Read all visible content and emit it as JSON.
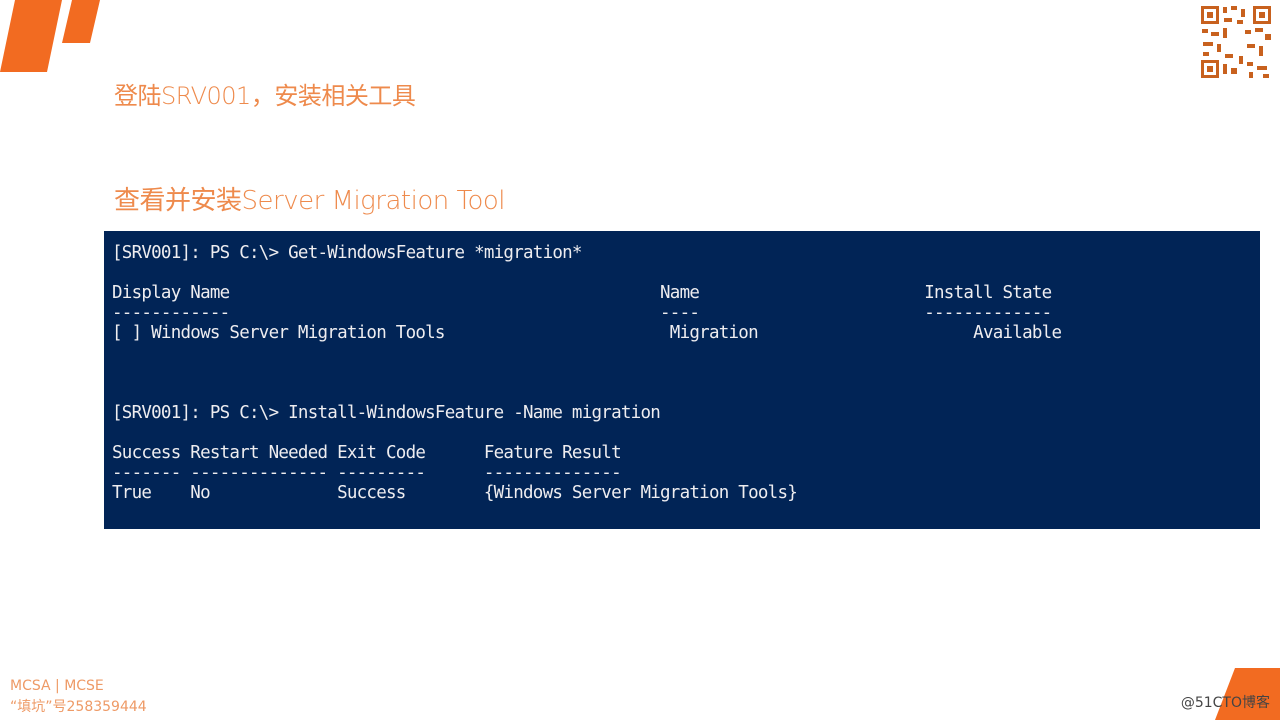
{
  "slide": {
    "heading1": "登陆SRV001，安装相关工具",
    "heading2": "查看并安装Server Migration Tool",
    "accent_color": "#f26b21",
    "terminal_bg": "#012456"
  },
  "terminal": {
    "lines": [
      "[SRV001]: PS C:\\> Get-WindowsFeature *migration*",
      "Display Name                                            Name                       Install State",
      "------------                                            ----                       -------------",
      "[ ] Windows Server Migration Tools                       Migration                      Available",
      "[SRV001]: PS C:\\> Install-WindowsFeature -Name migration",
      "Success Restart Needed Exit Code      Feature Result",
      "------- -------------- ---------      --------------",
      "True    No             Success        {Windows Server Migration Tools}"
    ]
  },
  "footer": {
    "line1": "MCSA | MCSE",
    "line2": "“填坑”号258359444",
    "watermark": "@51CTO博客"
  },
  "icons": {
    "qr": "qr-code-icon",
    "logo": "quote-logo-icon"
  }
}
